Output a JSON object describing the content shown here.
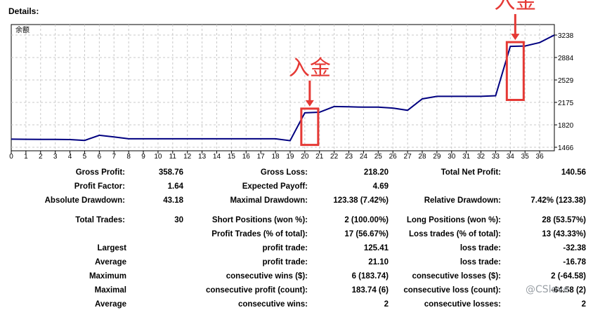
{
  "section_title": "Details:",
  "chart_data": {
    "type": "line",
    "title": "余额",
    "x": [
      0,
      1,
      2,
      3,
      4,
      5,
      6,
      7,
      8,
      9,
      10,
      11,
      12,
      13,
      14,
      15,
      16,
      17,
      18,
      19,
      20,
      21,
      22,
      23,
      24,
      25,
      26,
      27,
      28,
      29,
      30,
      31,
      32,
      33,
      34,
      35,
      36,
      37
    ],
    "series": [
      {
        "values": [
          1595,
          1592,
          1590,
          1590,
          1588,
          1574,
          1655,
          1630,
          1600,
          1600,
          1600,
          1600,
          1600,
          1600,
          1600,
          1600,
          1600,
          1600,
          1600,
          1570,
          2010,
          2020,
          2110,
          2105,
          2100,
          2100,
          2085,
          2050,
          2230,
          2270,
          2270,
          2270,
          2270,
          2280,
          3060,
          3065,
          3120,
          3238
        ]
      }
    ],
    "xticks": [
      "0",
      "2",
      "4",
      "6",
      "8",
      "10",
      "12",
      "14",
      "16",
      "18",
      "20",
      "22",
      "24",
      "26",
      "28",
      "30",
      "32",
      "34",
      "36"
    ],
    "xtick_values": [
      0,
      2,
      4,
      6,
      8,
      10,
      12,
      14,
      16,
      18,
      20,
      22,
      24,
      26,
      28,
      30,
      32,
      34,
      36
    ],
    "xticks_odd": [
      "1",
      "3",
      "5",
      "7",
      "9",
      "11",
      "13",
      "15",
      "17",
      "19",
      "21",
      "23",
      "25",
      "27",
      "29",
      "31",
      "33",
      "35"
    ],
    "xtick_odd_values": [
      1,
      3,
      5,
      7,
      9,
      11,
      13,
      15,
      17,
      19,
      21,
      23,
      25,
      27,
      29,
      31,
      33,
      35
    ],
    "yticks": [
      "3238",
      "2884",
      "2529",
      "2175",
      "1820",
      "1466"
    ],
    "ytick_values": [
      3238,
      2884,
      2529,
      2175,
      1820,
      1466
    ],
    "ylim": [
      1466,
      3238
    ],
    "xlim": [
      0,
      37
    ],
    "grid": true,
    "line_color": "#000080",
    "annotations": [
      {
        "text": "入金",
        "x_from": 19,
        "x_to": 20,
        "color": "#e53935"
      },
      {
        "text": "入金",
        "x_from": 33,
        "x_to": 34,
        "color": "#e53935"
      }
    ]
  },
  "stats": {
    "gross_profit": {
      "label": "Gross Profit:",
      "value": "358.76"
    },
    "gross_loss": {
      "label": "Gross Loss:",
      "value": "218.20"
    },
    "total_net_profit": {
      "label": "Total Net Profit:",
      "value": "140.56"
    },
    "profit_factor": {
      "label": "Profit Factor:",
      "value": "1.64"
    },
    "expected_payoff": {
      "label": "Expected Payoff:",
      "value": "4.69"
    },
    "absolute_drawdown": {
      "label": "Absolute Drawdown:",
      "value": "43.18"
    },
    "maximal_drawdown": {
      "label": "Maximal Drawdown:",
      "value": "123.38 (7.42%)"
    },
    "relative_drawdown": {
      "label": "Relative Drawdown:",
      "value": "7.42% (123.38)"
    },
    "total_trades": {
      "label": "Total Trades:",
      "value": "30"
    },
    "short_positions": {
      "label": "Short Positions (won %):",
      "value": "2 (100.00%)"
    },
    "long_positions": {
      "label": "Long Positions (won %):",
      "value": "28 (53.57%)"
    },
    "profit_trades": {
      "label": "Profit Trades (% of total):",
      "value": "17 (56.67%)"
    },
    "loss_trades": {
      "label": "Loss trades (% of total):",
      "value": "13 (43.33%)"
    },
    "largest": {
      "label": "Largest",
      "profit_label": "profit trade:",
      "profit_value": "125.41",
      "loss_label": "loss trade:",
      "loss_value": "-32.38"
    },
    "average": {
      "label": "Average",
      "profit_label": "profit trade:",
      "profit_value": "21.10",
      "loss_label": "loss trade:",
      "loss_value": "-16.78"
    },
    "maximum": {
      "label": "Maximum",
      "profit_label": "consecutive wins ($):",
      "profit_value": "6 (183.74)",
      "loss_label": "consecutive losses ($):",
      "loss_value": "2 (-64.58)"
    },
    "maximal": {
      "label": "Maximal",
      "profit_label": "consecutive profit (count):",
      "profit_value": "183.74 (6)",
      "loss_label": "consecutive loss (count):",
      "loss_value": "-64.58 (2)"
    },
    "average2": {
      "label": "Average",
      "profit_label": "consecutive wins:",
      "profit_value": "2",
      "loss_label": "consecutive losses:",
      "loss_value": "2"
    }
  },
  "watermark": "@CSlove"
}
